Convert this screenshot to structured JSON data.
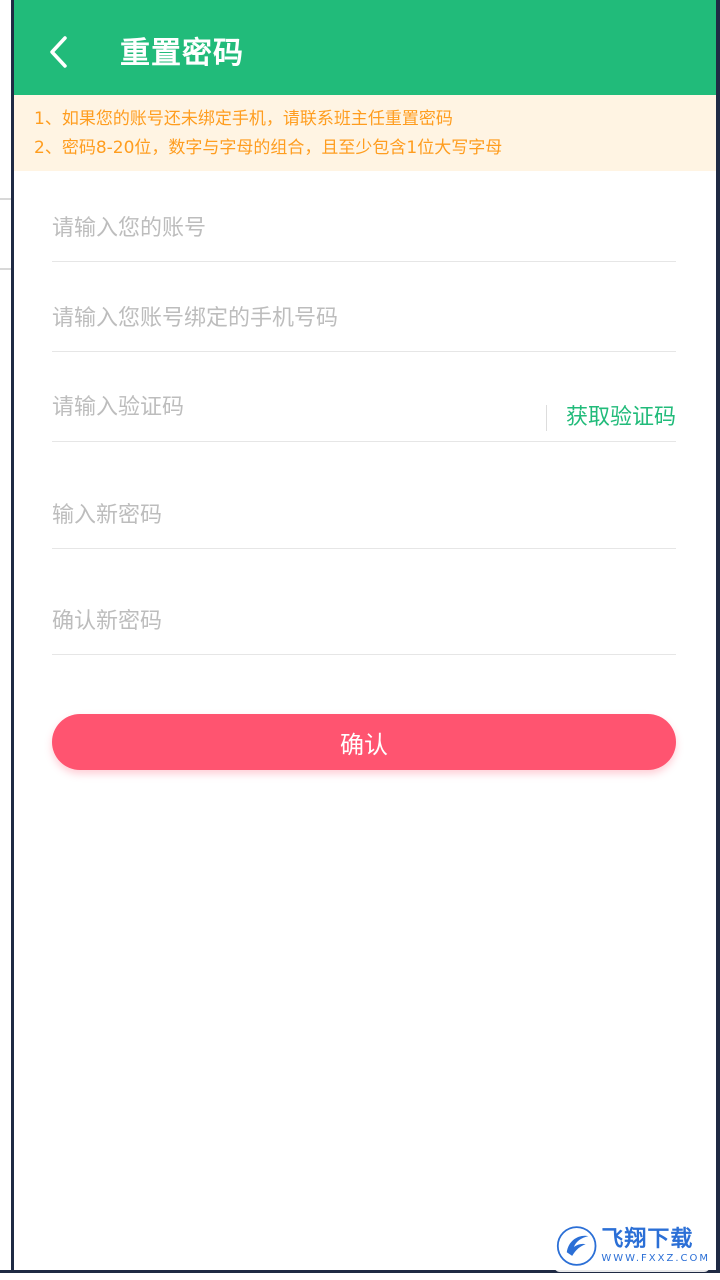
{
  "colors": {
    "header_bg": "#21bb7a",
    "notice_bg": "#fff4e3",
    "notice_text": "#ff9d1f",
    "accent_green": "#21bb7a",
    "confirm_bg": "#ff5470"
  },
  "header": {
    "back_icon": "chevron-left-icon",
    "title": "重置密码"
  },
  "notice": {
    "lines": [
      "1、如果您的账号还未绑定手机，请联系班主任重置密码",
      "2、密码8-20位，数字与字母的组合，且至少包含1位大写字母"
    ]
  },
  "form": {
    "account": {
      "placeholder": "请输入您的账号",
      "value": ""
    },
    "phone": {
      "placeholder": "请输入您账号绑定的手机号码",
      "value": ""
    },
    "code": {
      "placeholder": "请输入验证码",
      "value": "",
      "button_label": "获取验证码"
    },
    "new_password": {
      "placeholder": "输入新密码",
      "value": ""
    },
    "confirm_password": {
      "placeholder": "确认新密码",
      "value": ""
    },
    "submit_label": "确认"
  },
  "watermark": {
    "main": "飞翔下载",
    "sub": "WWW.FXXZ.COM"
  }
}
